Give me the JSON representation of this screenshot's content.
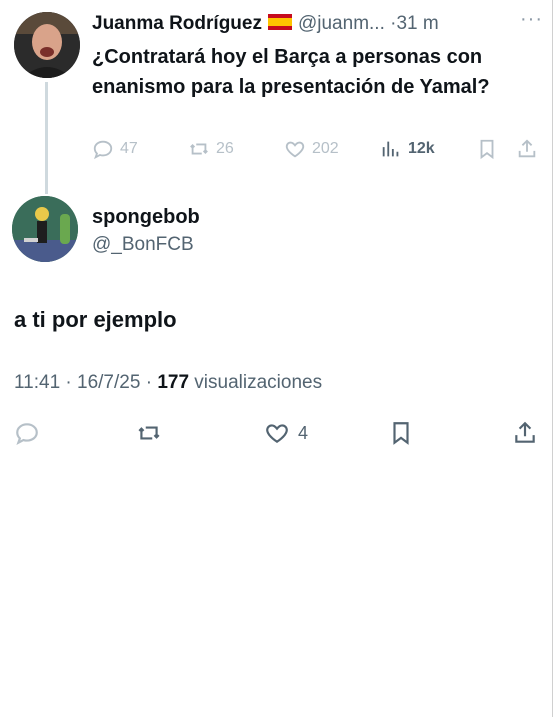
{
  "parent_tweet": {
    "author_name": "Juanma Rodríguez",
    "flag": "spain-flag",
    "handle": "@juanm...",
    "separator": "·",
    "time": "31 m",
    "more": "···",
    "text": "¿Contratará hoy el Barça a personas con enanismo para la presentación de Yamal?",
    "actions": {
      "replies": "47",
      "retweets": "26",
      "likes": "202",
      "views": "12k"
    },
    "icons": [
      "reply-icon",
      "retweet-icon",
      "like-icon",
      "views-icon",
      "bookmark-icon",
      "share-icon"
    ]
  },
  "reply_tweet": {
    "author_name": "spongebob",
    "handle": "@_BonFCB",
    "text": "a ti por ejemplo",
    "timestamp": "11:41 · 16/7/25 · ",
    "views_count": "177",
    "views_label": " visualizaciones",
    "actions": {
      "likes": "4"
    },
    "icons": [
      "reply-icon",
      "retweet-icon",
      "like-icon",
      "bookmark-icon",
      "share-icon"
    ]
  },
  "colors": {
    "text": "#0f1419",
    "muted": "#536471",
    "faded_icon": "#b6c0c8",
    "thread_line": "#cfd9de"
  }
}
